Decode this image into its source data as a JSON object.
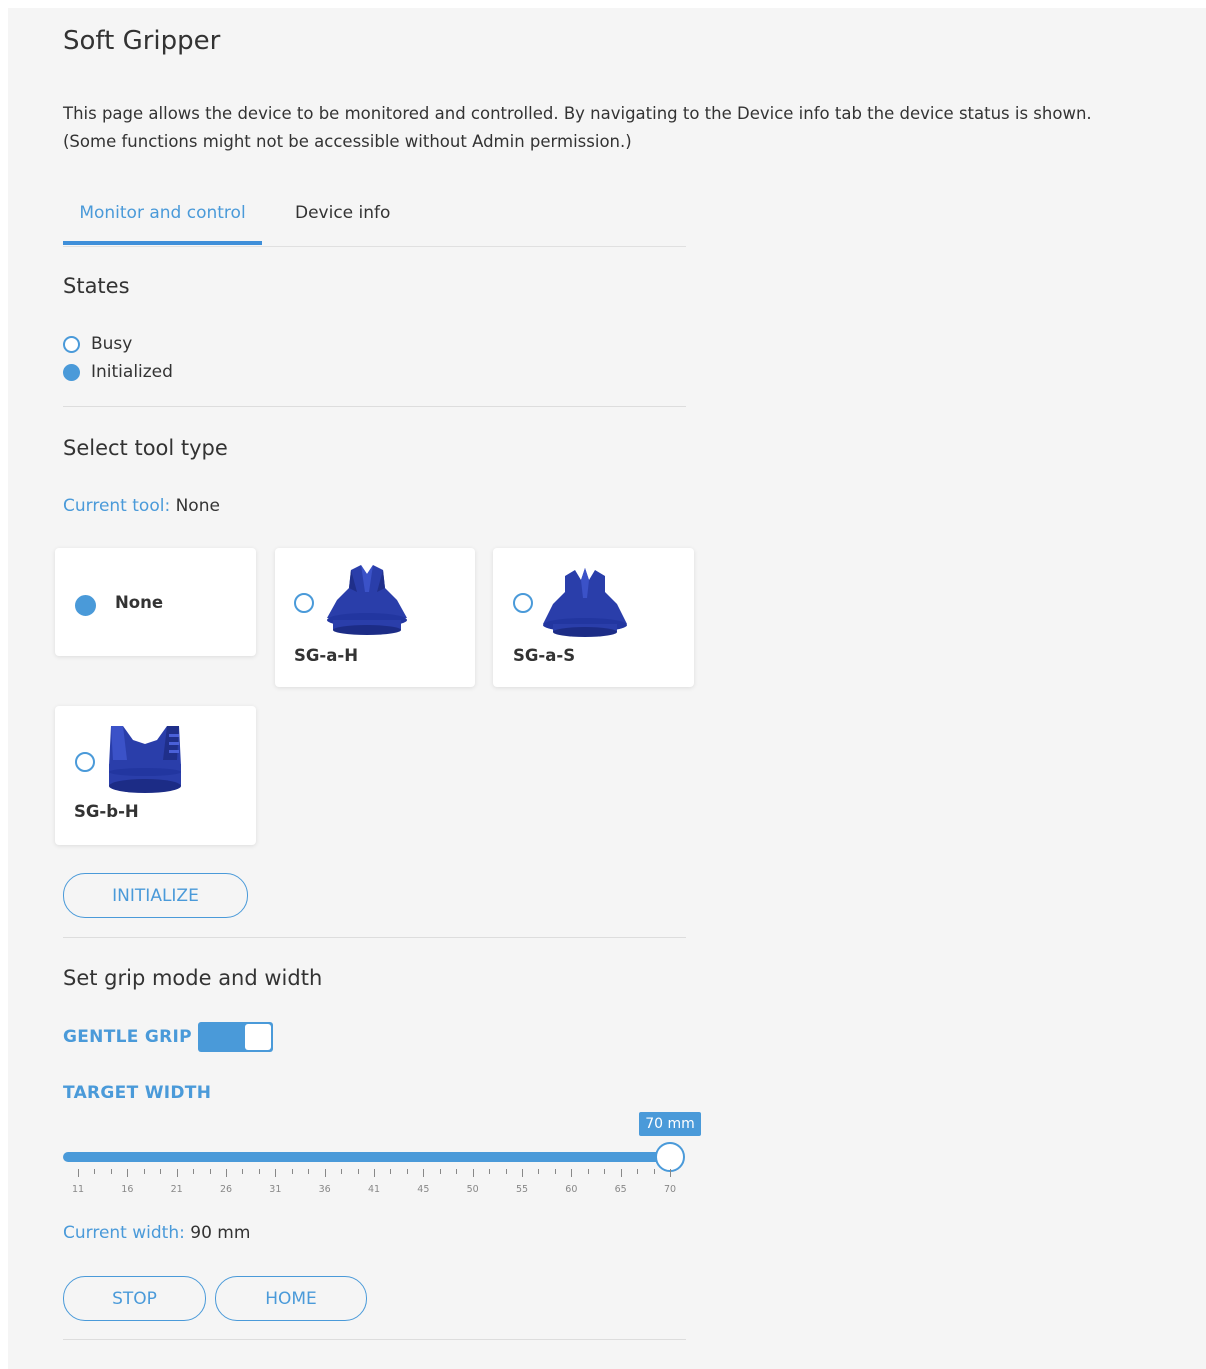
{
  "page": {
    "title": "Soft Gripper",
    "description_line1": "This page allows the device to be monitored and controlled. By navigating to the Device info tab the device status is shown.",
    "description_line2": "(Some functions might not be accessible without Admin permission.)"
  },
  "tabs": [
    {
      "label": "Monitor and control",
      "active": true
    },
    {
      "label": "Device info",
      "active": false
    }
  ],
  "states": {
    "title": "States",
    "items": [
      {
        "label": "Busy",
        "active": false
      },
      {
        "label": "Initialized",
        "active": true
      }
    ]
  },
  "tool_type": {
    "title": "Select tool type",
    "current_label": "Current tool:",
    "current_value": "None",
    "options": [
      {
        "label": "None",
        "selected": true
      },
      {
        "label": "SG-a-H",
        "selected": false,
        "icon": "gripper-a-h-icon"
      },
      {
        "label": "SG-a-S",
        "selected": false,
        "icon": "gripper-a-s-icon"
      },
      {
        "label": "SG-b-H",
        "selected": false,
        "icon": "gripper-b-h-icon"
      }
    ],
    "initialize_label": "INITIALIZE"
  },
  "grip": {
    "title": "Set grip mode and width",
    "gentle_grip_label": "GENTLE GRIP",
    "gentle_grip_on": true,
    "target_width_label": "TARGET WIDTH",
    "target_width_value": "70 mm",
    "slider_min": 11,
    "slider_max": 70,
    "slider_value": 70,
    "tick_labels": [
      "11",
      "16",
      "21",
      "26",
      "31",
      "36",
      "41",
      "45",
      "50",
      "55",
      "60",
      "65",
      "70"
    ],
    "current_width_label": "Current width:",
    "current_width_value": "90 mm",
    "stop_label": "STOP",
    "home_label": "HOME"
  },
  "colors": {
    "accent": "#4a9ad9",
    "background": "#f5f5f5",
    "gripper_blue": "#2a3eaa"
  }
}
